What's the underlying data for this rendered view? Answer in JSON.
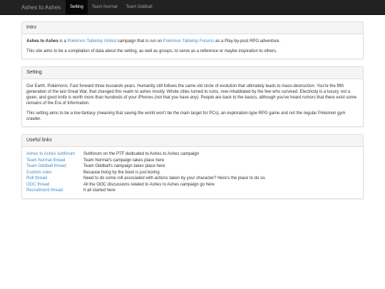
{
  "navbar": {
    "brand": "Ashes to Ashes",
    "items": [
      {
        "label": "Setting",
        "active": true
      },
      {
        "label": "Team Normal",
        "active": false
      },
      {
        "label": "Team Oddball",
        "active": false
      }
    ]
  },
  "intro": {
    "heading": "Intro",
    "p1": {
      "bold": "Ashes to Ashes",
      "t1": " is a ",
      "link1": "Pokémon Tabletop United",
      "t2": " campaign that is run on ",
      "link2": "Pokémon Tabletop Forums",
      "t3": " as a Play-by-post RPG adventure."
    },
    "p2": "This site aims to be a compilation of data about the setting, as well as groups, to serve as a reference or maybe inspiration to others."
  },
  "setting": {
    "heading": "Setting",
    "p1": "Our Earth. Pokémons. Fast forward three tousands years. Humanity still follows the same old circle of evolution that ultimately leads to mass-destruction. You're the fifth generation of the last Great War, that changed this realm to ashes mostly. Whole cities turned to ruins, now inhabitated by the few who survived. Electricity is a luxury, not a given, and good knife is worth more than hundreds of your iPhones (not that you have any). People are back to the basics, although you've heard rumors that there exist some remains of the Era of Information.",
    "p2": "This setting aims to be a low-fantasy (meaning that saving the world won't be the main target for PCs), an exploration-type RPG game and not the regular Pokémon gym crawler."
  },
  "links": {
    "heading": "Useful links",
    "rows": [
      {
        "label": "Ashes to Ashes subforum",
        "desc": "Subforum on the PTF dedicated to Ashes to Ashes campaign"
      },
      {
        "label": "Team Normal thread",
        "desc": "Team Normal's campaign takes place here"
      },
      {
        "label": "Team Oddball thread",
        "desc": "Team Oddball's campaign takes place here"
      },
      {
        "label": "Custom rules",
        "desc": "Because living by the book is just boring"
      },
      {
        "label": "Roll thread",
        "desc": "Need to do some roll associated with actions taken by your character? Here's the place to do so."
      },
      {
        "label": "OOC thread",
        "desc": "All the OOC discussions related to Ashes to Ashes campaign go here"
      },
      {
        "label": "Recruitment thread",
        "desc": "It all started here"
      }
    ]
  }
}
